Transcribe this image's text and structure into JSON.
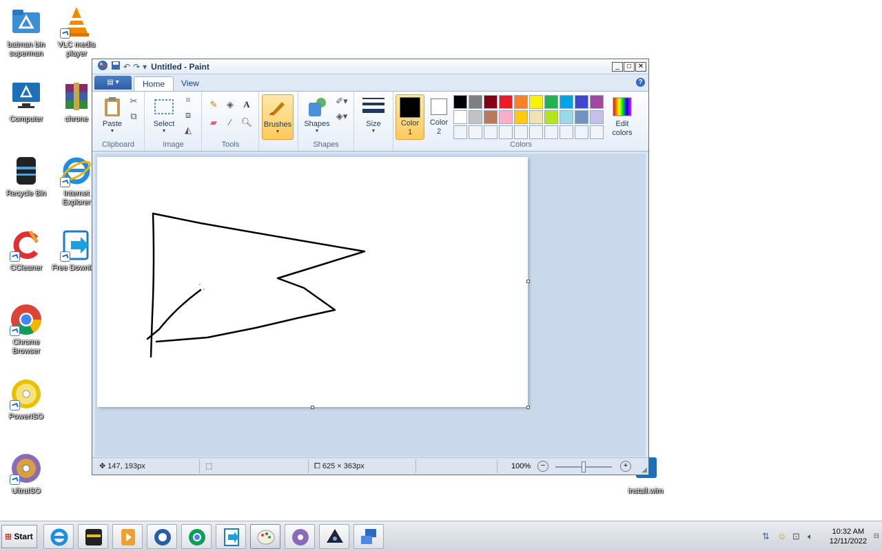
{
  "desktop_icons": [
    {
      "label": "batman bin superman",
      "icon": "folder-icon"
    },
    {
      "label": "VLC media player",
      "icon": "vlc-icon"
    },
    {
      "label": "Computer",
      "icon": "computer-icon"
    },
    {
      "label": "chrone",
      "icon": "winrar-icon"
    },
    {
      "label": "Recycle Bin",
      "icon": "recycle-bin-icon"
    },
    {
      "label": "Internet Explorer",
      "icon": "ie-icon"
    },
    {
      "label": "CCleaner",
      "icon": "ccleaner-icon"
    },
    {
      "label": "Free Downlo...",
      "icon": "download-icon"
    },
    {
      "label": "Chrome Browser",
      "icon": "chrome-icon"
    },
    {
      "label": "PowerISO",
      "icon": "poweriso-icon"
    },
    {
      "label": "UltraISO",
      "icon": "ultraiso-icon"
    },
    {
      "label": "install.wim",
      "icon": "file-icon"
    }
  ],
  "window": {
    "title": "Untitled - Paint",
    "tabs": [
      "Home",
      "View"
    ],
    "help": "?",
    "ribbon": {
      "clipboard": {
        "label": "Clipboard",
        "paste": "Paste"
      },
      "image": {
        "label": "Image",
        "select": "Select"
      },
      "tools": {
        "label": "Tools"
      },
      "brushes": "Brushes",
      "shapes": {
        "label": "Shapes",
        "button": "Shapes"
      },
      "size": "Size",
      "colors": {
        "label": "Colors",
        "color1_line1": "Color",
        "color1_line2": "1",
        "color2_line1": "Color",
        "color2_line2": "2",
        "edit_line1": "Edit",
        "edit_line2": "colors",
        "color1": "#000000",
        "color2": "#ffffff",
        "palette": [
          "#000000",
          "#7f7f7f",
          "#880015",
          "#ed1c24",
          "#ff7f27",
          "#fff200",
          "#22b14c",
          "#00a2e8",
          "#3f48cc",
          "#a349a4",
          "#ffffff",
          "#c3c3c3",
          "#b97a57",
          "#ffaec9",
          "#ffc90e",
          "#efe4b0",
          "#b5e61d",
          "#99d9ea",
          "#7092be",
          "#c8bfe7",
          "#f0f3f8",
          "#f0f3f8",
          "#f0f3f8",
          "#f0f3f8",
          "#f0f3f8",
          "#f0f3f8",
          "#f0f3f8",
          "#f0f3f8",
          "#f0f3f8",
          "#f0f3f8"
        ]
      }
    },
    "status": {
      "cursor_pos": "147, 193px",
      "canvas_size": "625 × 363px",
      "zoom": "100%",
      "zoom_slider_fraction": 0.5
    }
  },
  "taskbar": {
    "start": "Start",
    "time": "10:32 AM",
    "date": "12/11/2022"
  }
}
